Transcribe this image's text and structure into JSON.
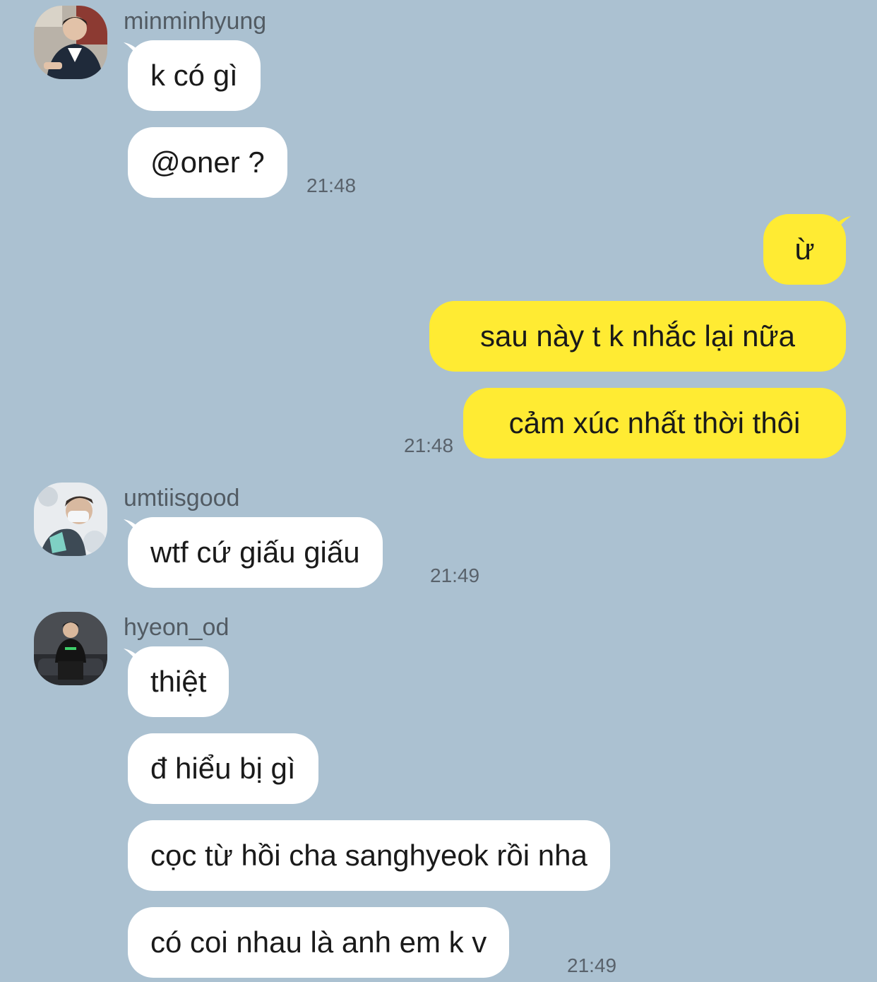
{
  "colors": {
    "background": "#abc1d1",
    "incoming_bubble": "#ffffff",
    "outgoing_bubble": "#ffeb33"
  },
  "group1": {
    "username": "minminhyung",
    "messages": [
      "k có gì",
      "@oner ?"
    ],
    "time": "21:48"
  },
  "group2": {
    "messages": [
      "ừ",
      "sau này t k nhắc lại nữa",
      "cảm xúc nhất thời thôi"
    ],
    "time": "21:48"
  },
  "group3": {
    "username": "umtiisgood",
    "messages": [
      "wtf cứ giấu giấu"
    ],
    "time": "21:49"
  },
  "group4": {
    "username": "hyeon_od",
    "messages": [
      "thiệt",
      "đ hiểu bị gì",
      "cọc từ hồi cha sanghyeok rồi nha",
      "có coi nhau là anh em k v"
    ],
    "time": "21:49"
  }
}
